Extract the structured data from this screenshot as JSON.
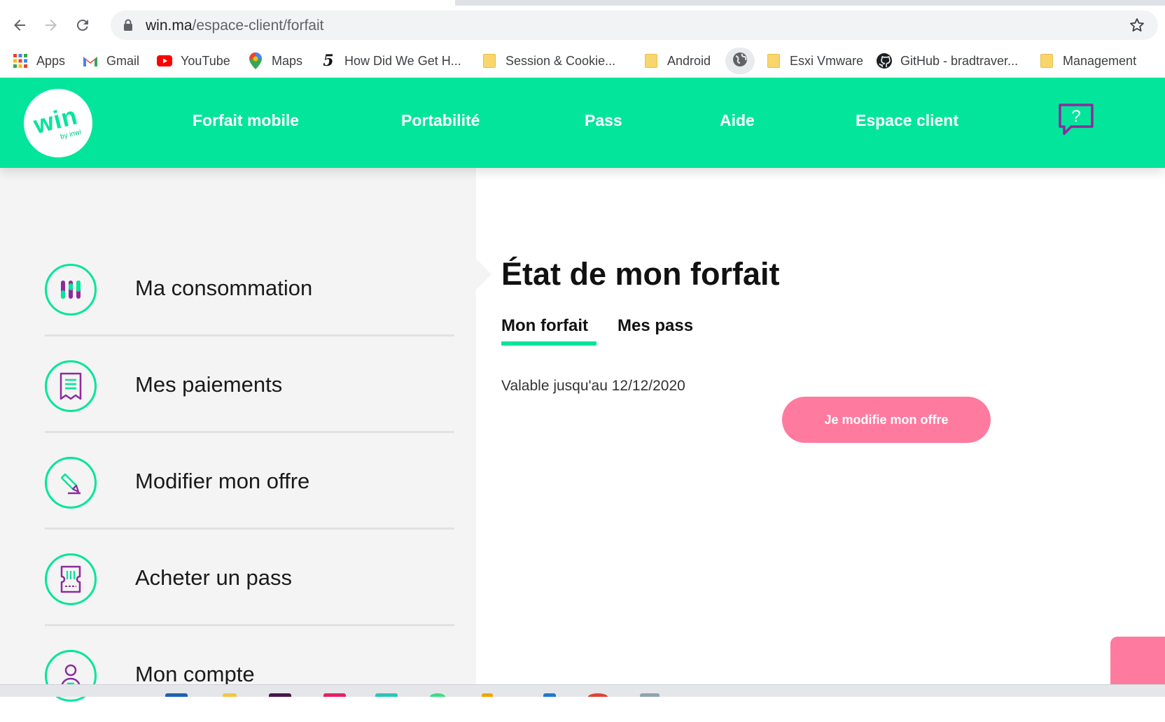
{
  "browser": {
    "url_host": "win.ma",
    "url_path": "/espace-client/forfait",
    "bookmarks": [
      {
        "label": "Apps",
        "icon": "apps-grid-icon"
      },
      {
        "label": "Gmail",
        "icon": "gmail-icon"
      },
      {
        "label": "YouTube",
        "icon": "youtube-icon"
      },
      {
        "label": "Maps",
        "icon": "maps-pin-icon"
      },
      {
        "label": "How Did We Get H...",
        "icon": "five-icon"
      },
      {
        "label": "Session & Cookie...",
        "icon": "folder-icon"
      },
      {
        "label": "Android",
        "icon": "folder-icon"
      },
      {
        "label": "Esxi Vmware",
        "icon": "folder-icon"
      },
      {
        "label": "GitHub - bradtraver...",
        "icon": "github-icon"
      },
      {
        "label": "Management",
        "icon": "folder-icon"
      }
    ]
  },
  "header": {
    "logo_text": "win",
    "logo_sub": "by inwi",
    "nav": [
      "Forfait mobile",
      "Portabilité",
      "Pass",
      "Aide",
      "Espace client"
    ],
    "help_symbol": "?"
  },
  "sidebar": {
    "items": [
      {
        "label": "Ma consommation",
        "icon": "consumption-bars-icon"
      },
      {
        "label": "Mes paiements",
        "icon": "receipt-icon"
      },
      {
        "label": "Modifier mon offre",
        "icon": "pencil-edit-icon"
      },
      {
        "label": "Acheter un pass",
        "icon": "ticket-icon"
      },
      {
        "label": "Mon compte",
        "icon": "user-account-icon"
      }
    ]
  },
  "main": {
    "title": "État de mon forfait",
    "tabs": [
      "Mon forfait",
      "Mes pass"
    ],
    "validity": "Valable jusqu'au 12/12/2020",
    "cta_label": "Je modifie mon offre"
  },
  "colors": {
    "brand_green": "#03e59a",
    "accent_pink": "#ff7a9f",
    "icon_purple": "#8e2a9e",
    "sidebar_bg": "#f4f4f4"
  }
}
